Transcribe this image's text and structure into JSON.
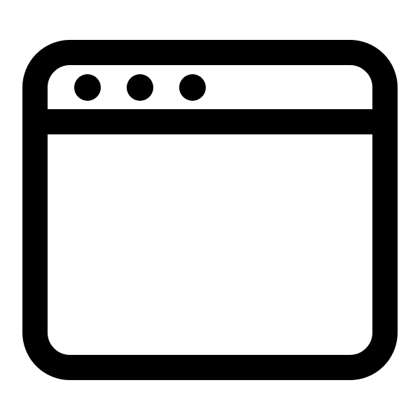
{
  "icon": {
    "name": "browser-window-icon",
    "stroke_color": "#000000",
    "background_color": "#ffffff",
    "title_bar_dots": 3
  }
}
